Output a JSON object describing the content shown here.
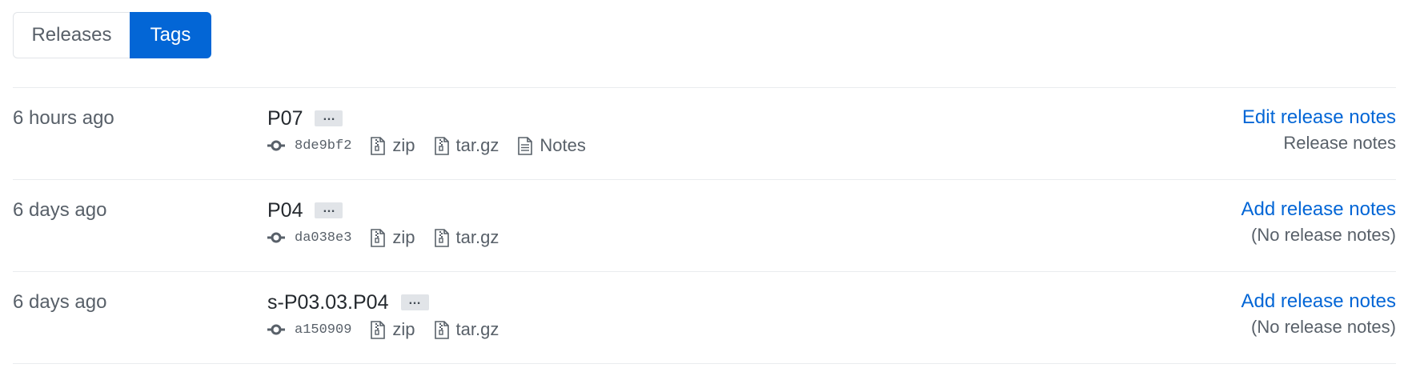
{
  "tabs": [
    {
      "label": "Releases",
      "selected": false
    },
    {
      "label": "Tags",
      "selected": true
    }
  ],
  "colors": {
    "accent": "#0366d6",
    "muted_text": "#586069",
    "border": "#eaecef",
    "ellipsis_bg": "#e1e4e8"
  },
  "tags": [
    {
      "date": "6 hours ago",
      "name": "P07",
      "ellipsis": "…",
      "commit": "8de9bf2",
      "downloads": {
        "zip": "zip",
        "targz": "tar.gz"
      },
      "notes_link": "Notes",
      "action": "Edit release notes",
      "sub": "Release notes"
    },
    {
      "date": "6 days ago",
      "name": "P04",
      "ellipsis": "…",
      "commit": "da038e3",
      "downloads": {
        "zip": "zip",
        "targz": "tar.gz"
      },
      "action": "Add release notes",
      "sub": "(No release notes)"
    },
    {
      "date": "6 days ago",
      "name": "s-P03.03.P04",
      "ellipsis": "…",
      "commit": "a150909",
      "downloads": {
        "zip": "zip",
        "targz": "tar.gz"
      },
      "action": "Add release notes",
      "sub": "(No release notes)"
    }
  ],
  "icons": {
    "commit": "git-commit-icon",
    "zip": "file-zip-icon",
    "targz": "file-zip-icon",
    "notes": "file-text-icon"
  }
}
